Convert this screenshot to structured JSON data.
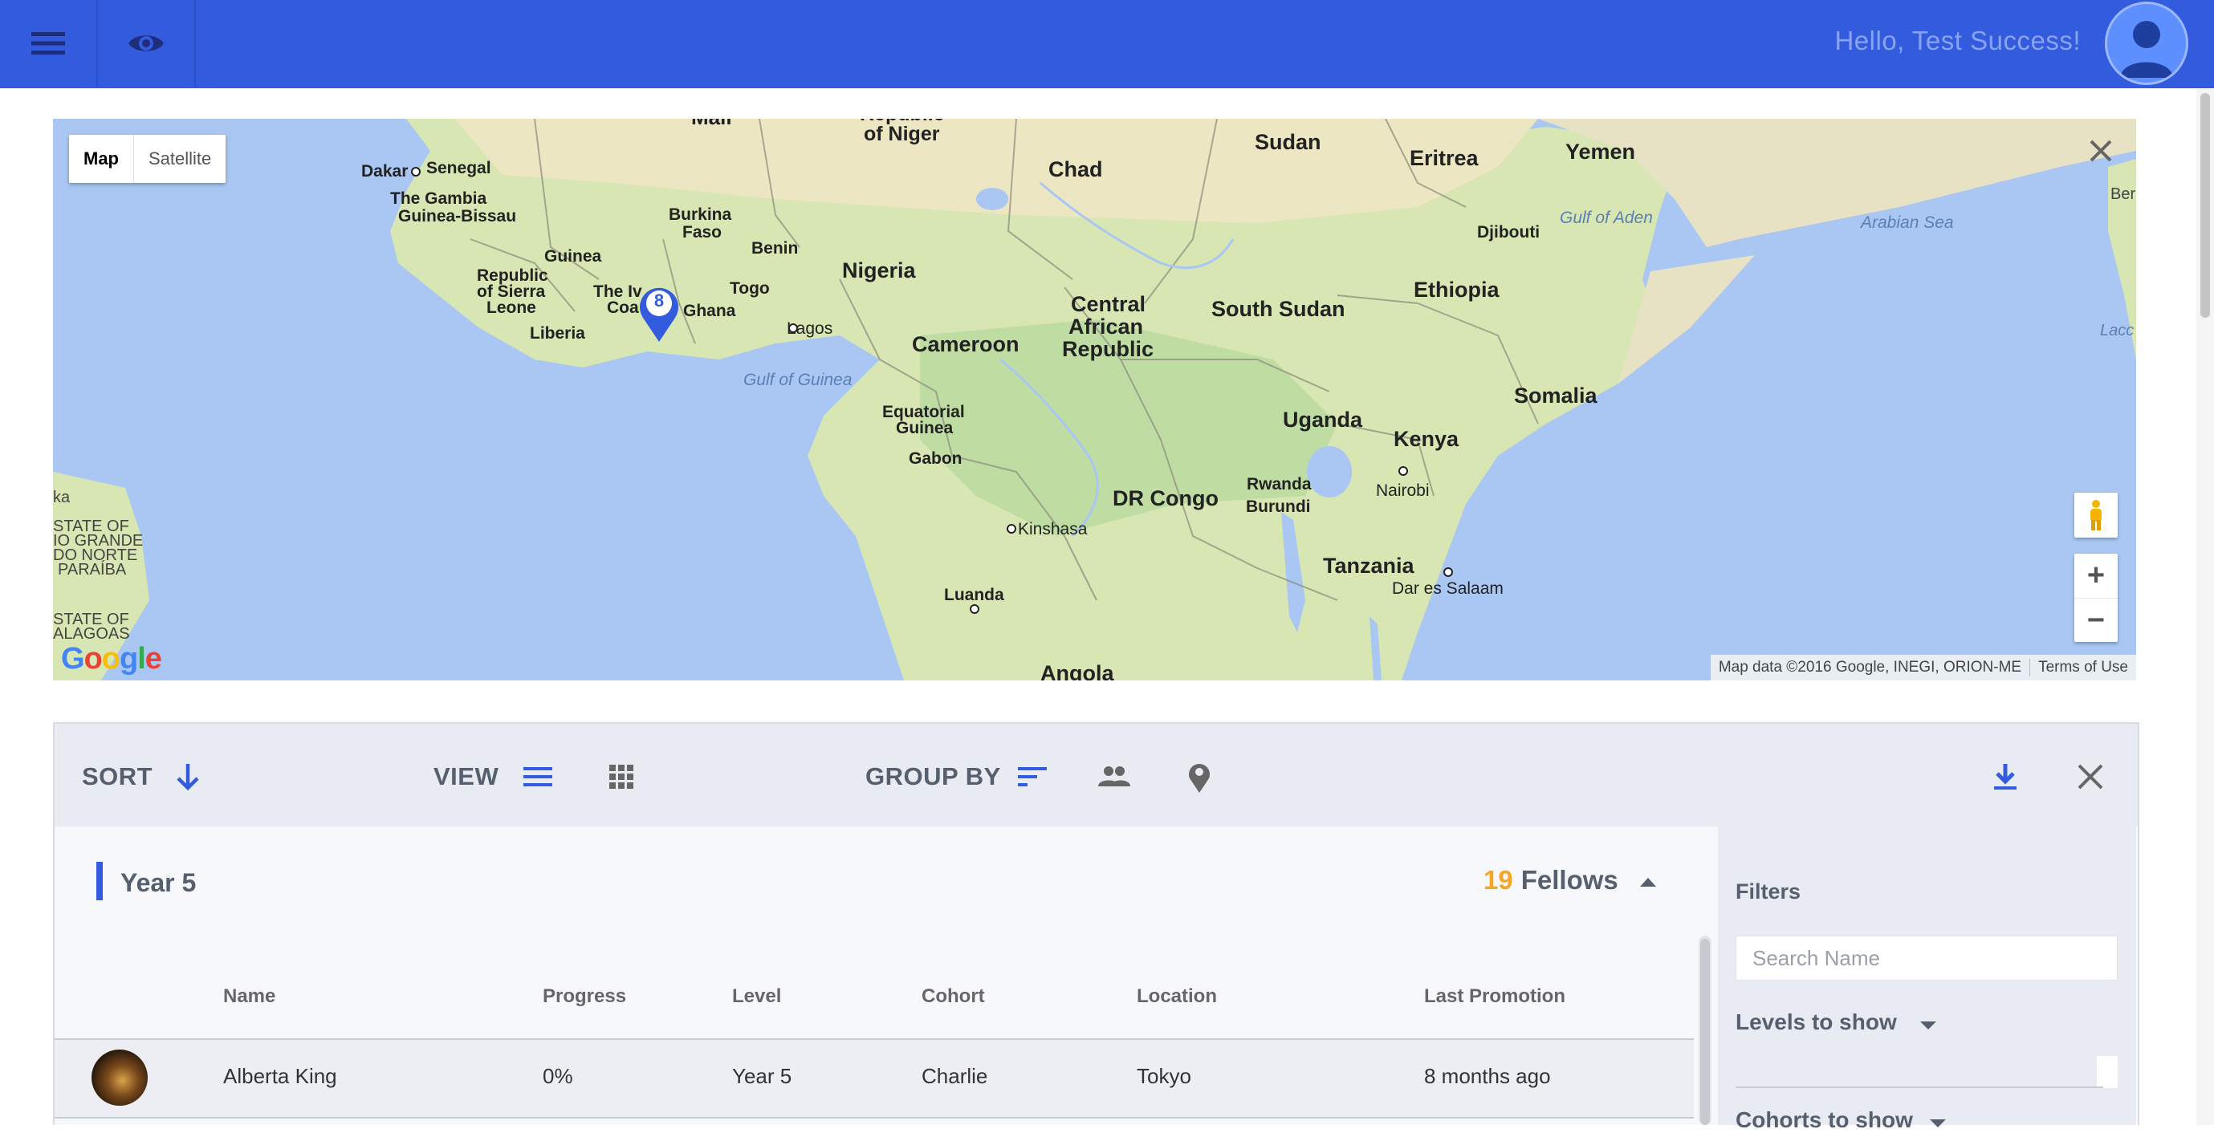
{
  "header": {
    "greeting": "Hello, Test Success!",
    "menu_icon": "menu-icon",
    "view_icon": "eye-icon",
    "avatar_icon": "user-avatar-icon"
  },
  "map": {
    "type_map_label": "Map",
    "type_satellite_label": "Satellite",
    "marker_count": "8",
    "google_logo": "Google",
    "attribution": "Map data ©2016 Google, INEGI, ORION-ME",
    "terms": "Terms of Use",
    "labels": [
      "Mali",
      "Republic of Niger",
      "Sudan",
      "Eritrea",
      "Yemen",
      "Chad",
      "Dakar",
      "Senegal",
      "The Gambia",
      "Guinea-Bissau",
      "Burkina Faso",
      "Djibouti",
      "Gulf of Aden",
      "Arabian Sea",
      "Guinea",
      "Benin",
      "Nigeria",
      "Ethiopia",
      "Republic of Sierra Leone",
      "Togo",
      "The Ivory Coast",
      "Ghana",
      "Liberia",
      "Lagos",
      "Central African Republic",
      "South Sudan",
      "Cameroon",
      "Gulf of Guinea",
      "Somalia",
      "Equatorial Guinea",
      "Gabon",
      "Uganda",
      "Kenya",
      "Nairobi",
      "Rwanda",
      "Burundi",
      "DR Congo",
      "Kinshasa",
      "Tanzania",
      "Dar es Salaam",
      "Luanda",
      "Angola",
      "STATE OF RIO GRANDE DO NORTE",
      "PARAÍBA",
      "STATE OF ALAGOAS",
      "Ber",
      "Lacc",
      "ka"
    ],
    "colors": {
      "water": "#a9c7f2",
      "land": "#d7e6b3",
      "marker": "#335bde"
    }
  },
  "toolbar": {
    "sort_label": "SORT",
    "view_label": "VIEW",
    "group_by_label": "GROUP BY"
  },
  "group": {
    "title": "Year 5",
    "count": "19",
    "count_label": "Fellows"
  },
  "table": {
    "columns": [
      "Name",
      "Progress",
      "Level",
      "Cohort",
      "Location",
      "Last Promotion"
    ],
    "rows": [
      {
        "name": "Alberta King",
        "progress": "0%",
        "level": "Year 5",
        "cohort": "Charlie",
        "location": "Tokyo",
        "last_promotion": "8 months ago"
      }
    ]
  },
  "filters": {
    "title": "Filters",
    "search_placeholder": "Search Name",
    "levels_label": "Levels to show",
    "cohorts_label": "Cohorts to show"
  },
  "theme": {
    "primary": "#335bde",
    "accent": "#f5a623",
    "toolbar_bg": "#e9ebf2"
  }
}
